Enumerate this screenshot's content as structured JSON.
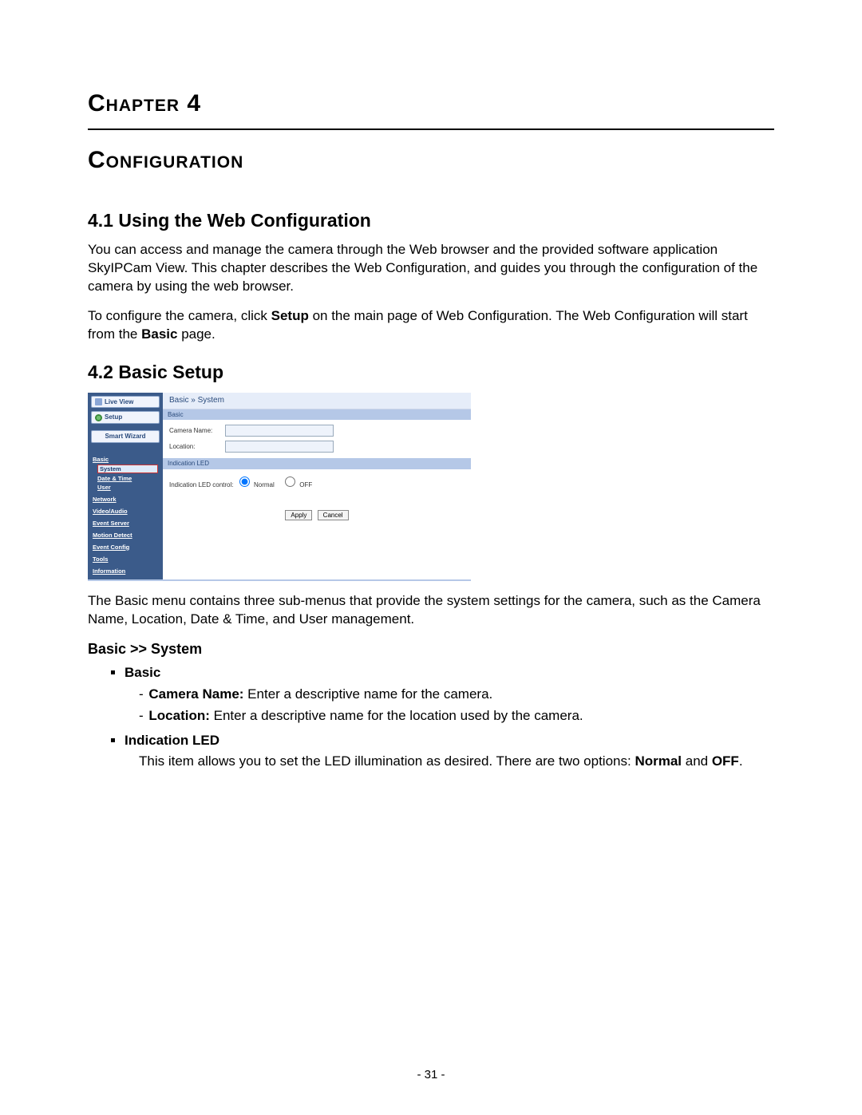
{
  "chapter_line": "Chapter 4",
  "title": "Configuration",
  "s41_heading": "4.1  Using the Web Configuration",
  "s41_p1": "You can access and manage the camera through the Web browser and the provided software application SkyIPCam View. This chapter describes the Web Configuration, and guides you through the configuration of the camera by using the web browser.",
  "s41_p2_a": "To configure the camera, click ",
  "s41_p2_setup": "Setup",
  "s41_p2_b": " on the main page of Web Configuration. The Web Configuration will start from the ",
  "s41_p2_basic": "Basic",
  "s41_p2_c": " page.",
  "s42_heading": "4.2  Basic Setup",
  "ui": {
    "live_view": "Live View",
    "setup": "Setup",
    "smart_wizard": "Smart Wizard",
    "menu": {
      "basic": "Basic",
      "system": "System",
      "date_time": "Date & Time",
      "user": "User",
      "network": "Network",
      "video_audio": "Video/Audio",
      "event_server": "Event Server",
      "motion_detect": "Motion Detect",
      "event_config": "Event Config",
      "tools": "Tools",
      "information": "Information"
    },
    "breadcrumb": "Basic » System",
    "panel_basic": "Basic",
    "camera_name_label": "Camera Name:",
    "camera_name_value": "",
    "location_label": "Location:",
    "location_value": "",
    "panel_led": "Indication LED",
    "led_control_label": "Indication LED control:",
    "led_opt_normal": "Normal",
    "led_opt_off": "OFF",
    "apply": "Apply",
    "cancel": "Cancel"
  },
  "desc_after_ui": "The Basic menu contains three sub-menus that provide the system settings for the camera, such as the Camera Name, Location, Date & Time, and User management.",
  "sub_basic_system": "Basic >> System",
  "li_basic": "Basic",
  "cam_name_bold": "Camera Name:",
  "cam_name_text": " Enter a descriptive name for the camera.",
  "loc_bold": "Location:",
  "loc_text": " Enter a descriptive name for the location used by the camera.",
  "li_led": "Indication LED",
  "led_text_a": "This item allows you to set the LED illumination as desired. There are two options: ",
  "led_normal": "Normal",
  "led_and": " and ",
  "led_off": "OFF",
  "led_period": ".",
  "page_number": "- 31 -"
}
